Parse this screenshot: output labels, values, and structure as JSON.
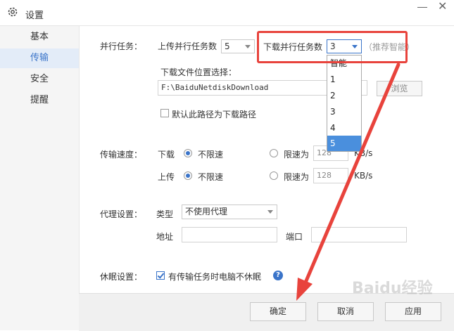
{
  "window": {
    "title": "设置",
    "title_icon": "gear-icon"
  },
  "sidebar": {
    "items": [
      {
        "label": "基本",
        "active": false
      },
      {
        "label": "传输",
        "active": true
      },
      {
        "label": "安全",
        "active": false
      },
      {
        "label": "提醒",
        "active": false
      }
    ]
  },
  "parallel": {
    "section_label": "并行任务：",
    "upload_label": "上传并行任务数",
    "upload_value": "5",
    "download_label": "下载并行任务数",
    "download_value": "3",
    "hint": "（推荐智能）",
    "options": [
      "智能",
      "1",
      "2",
      "3",
      "4",
      "5"
    ],
    "hovered_option": "5"
  },
  "location": {
    "label": "下载文件位置选择：",
    "path": "F:\\BaiduNetdiskDownload",
    "browse": "浏览",
    "default_checkbox": "默认此路径为下载路径",
    "default_checked": false
  },
  "speed": {
    "section_label": "传输速度：",
    "download_label": "下载",
    "upload_label": "上传",
    "unlimited": "不限速",
    "limit": "限速为",
    "download_limit": "128",
    "upload_limit": "128",
    "unit": "KB/s"
  },
  "proxy": {
    "section_label": "代理设置：",
    "type_label": "类型",
    "type_value": "不使用代理",
    "address_label": "地址",
    "port_label": "端口",
    "address_value": "",
    "port_value": ""
  },
  "sleep": {
    "section_label": "休眠设置：",
    "checkbox_label": "有传输任务时电脑不休眠",
    "checked": true,
    "help_icon": "question-icon"
  },
  "footer": {
    "ok": "确定",
    "cancel": "取消",
    "apply": "应用"
  },
  "watermark": "Baidu经验",
  "colors": {
    "accent": "#3a74c9",
    "annotation": "#e8433c",
    "selected_option": "#4a8fdd"
  }
}
